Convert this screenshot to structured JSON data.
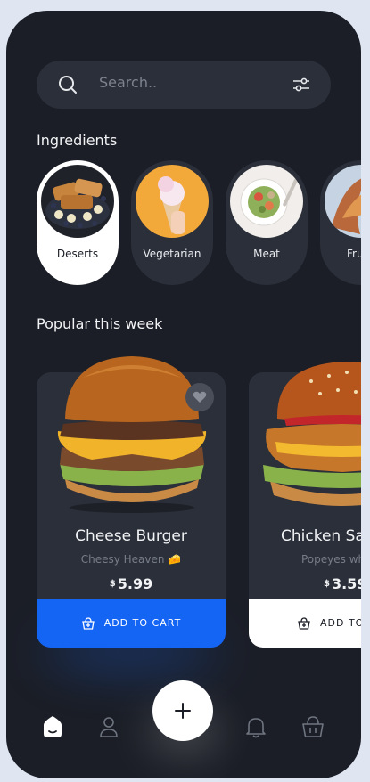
{
  "search": {
    "placeholder": "Search.."
  },
  "ingredients": {
    "title": "Ingredients",
    "items": [
      {
        "label": "Deserts",
        "active": true
      },
      {
        "label": "Vegetarian",
        "active": false
      },
      {
        "label": "Meat",
        "active": false
      },
      {
        "label": "Fru",
        "active": false
      }
    ]
  },
  "popular": {
    "title": "Popular this week",
    "items": [
      {
        "name": "Cheese Burger",
        "subtitle": "Cheesy Heaven 🧀",
        "currency": "$",
        "price": "5.99",
        "cart_label": "ADD TO CART"
      },
      {
        "name": "Chicken San",
        "subtitle": "Popeyes wh",
        "currency": "$",
        "price": "3.59",
        "cart_label": "ADD TO"
      }
    ]
  },
  "colors": {
    "accent": "#1565f5",
    "background": "#1b1e26",
    "surface": "#2b2f39"
  },
  "icons": {
    "search": "search-icon",
    "filter": "filter-icon",
    "heart": "heart-icon",
    "cart": "basket-icon",
    "home": "home-icon",
    "profile": "user-icon",
    "add": "plus-icon",
    "bell": "bell-icon",
    "basket": "basket-icon"
  }
}
